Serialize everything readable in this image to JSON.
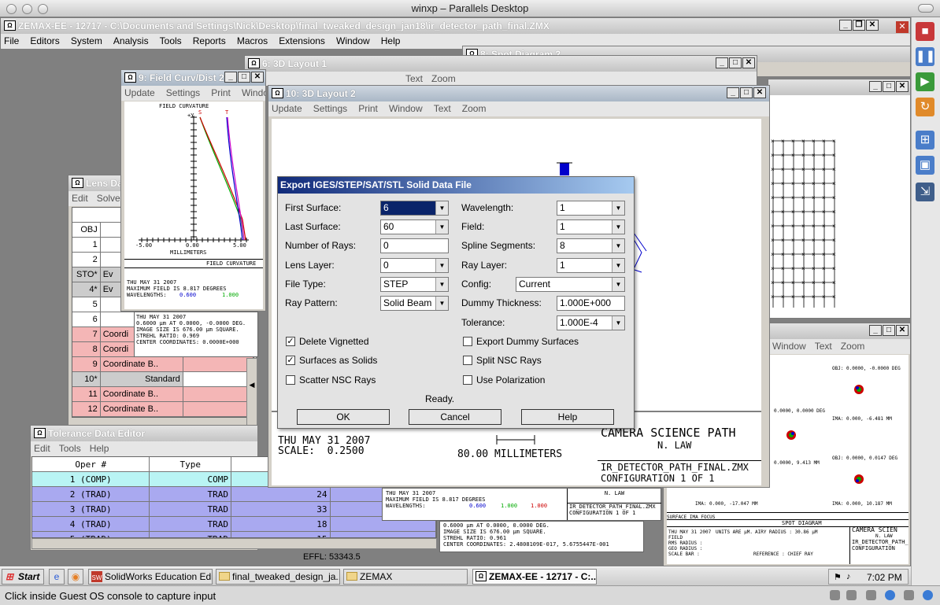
{
  "mac": {
    "title": "winxp – Parallels Desktop",
    "status": "Click inside Guest OS console to capture input"
  },
  "zemax": {
    "title": "ZEMAX-EE - 12717 - C:\\Documents and Settings\\Nick\\Desktop\\final_tweaked_design_jan18\\ir_detector_path_final.ZMX",
    "menu": [
      "File",
      "Editors",
      "System",
      "Analysis",
      "Tools",
      "Reports",
      "Macros",
      "Extensions",
      "Window",
      "Help"
    ]
  },
  "windows": {
    "spot_title": "8: Spot Diagram 2",
    "layout1_title": "6: 3D Layout 1",
    "layout1_menu": [
      "Text",
      "Zoom"
    ],
    "field_curv": {
      "title": "9: Field Curv/Dist 2",
      "menu": [
        "Update",
        "Settings",
        "Print",
        "Window"
      ],
      "plot_title": "FIELD CURVATURE",
      "y_label": "+Y",
      "s_label": "S",
      "t_label": "T",
      "x_ticks": [
        "-5.00",
        "0.00",
        "5.00"
      ],
      "x_label": "MILLIMETERS",
      "footer_label": "FIELD CURVATURE",
      "date": "THU MAY 31 2007",
      "max_field": "MAXIMUM FIELD IS 8.817 DEGREES",
      "wavelengths_label": "WAVELENGTHS:",
      "wl1": "0.600",
      "wl2": "1.000"
    },
    "layout2": {
      "title": "10: 3D Layout 2",
      "menu": [
        "Update",
        "Settings",
        "Print",
        "Window",
        "Text",
        "Zoom"
      ],
      "date": "THU MAY 31 2007",
      "scale": "SCALE:  0.2500",
      "scale_bar": "80.00 MILLIMETERS",
      "title_block": "CAMERA SCIENCE PATH",
      "author": "N. LAW",
      "file": "IR_DETECTOR_PATH_FINAL.ZMX",
      "config": "CONFIGURATION  1  OF  1"
    },
    "lens_data": {
      "title": "Lens Da",
      "menu": [
        "Edit",
        "Solves"
      ],
      "header": "Surf",
      "rows": [
        {
          "num": "OBJ",
          "type": ""
        },
        {
          "num": "1",
          "type": ""
        },
        {
          "num": "2",
          "type": ""
        },
        {
          "num": "STO*",
          "type": "Ev"
        },
        {
          "num": "4*",
          "type": "Ev"
        },
        {
          "num": "5",
          "type": ""
        },
        {
          "num": "6",
          "type": ""
        },
        {
          "num": "7",
          "type": "Coordi"
        },
        {
          "num": "8",
          "type": "Coordi"
        },
        {
          "num": "9",
          "type": "Coordinate B.."
        },
        {
          "num": "10*",
          "type": "Standard"
        },
        {
          "num": "11",
          "type": "Coordinate B.."
        },
        {
          "num": "12",
          "type": "Coordinate B.."
        }
      ]
    },
    "spot_small": {
      "date": "THU MAY 31 2007",
      "lines": [
        "0.6000 µm AT 0.0000, -0.0000 DEG.",
        "IMAGE SIZE IS 676.00 µm SQUARE.",
        "STREHL RATIO: 0.969",
        "CENTER COORDINATES: 0.0000E+000"
      ]
    },
    "tolerance": {
      "title": "Tolerance Data Editor",
      "menu": [
        "Edit",
        "Tools",
        "Help"
      ],
      "headers": [
        "Oper #",
        "Type"
      ],
      "rows": [
        {
          "oper": "1 (COMP)",
          "type": "COMP",
          "v": ""
        },
        {
          "oper": "2 (TRAD)",
          "type": "TRAD",
          "v": "24"
        },
        {
          "oper": "3 (TRAD)",
          "type": "TRAD",
          "v": "33"
        },
        {
          "oper": "4 (TRAD)",
          "type": "TRAD",
          "v": "18"
        },
        {
          "oper": "5 (TRAD)",
          "type": "TRAD",
          "v": "15"
        }
      ]
    },
    "effl": "EFFL: 53343.5",
    "fc2": {
      "date": "THU MAY 31 2007",
      "max_field": "MAXIMUM FIELD IS 8.817 DEGREES",
      "wavelengths_label": "WAVELENGTHS:",
      "wl1": "0.600",
      "wl2": "1.000",
      "wl3": "1.000",
      "title": "IR_DETECTOR_PATH_FINAL.ZMX",
      "author": "N. LAW",
      "config": "CONFIGURATION 1 OF 1"
    },
    "spot3": {
      "lines": [
        "0.6000 µm AT 0.0000, 0.0000 DEG.",
        "IMAGE SIZE IS 676.00 µm SQUARE.",
        "STREHL RATIO: 0.961",
        "CENTER COORDINATES: 2.4808109E-017, 5.6755447E-001"
      ]
    },
    "spot2": {
      "menu": [
        "Window",
        "Text",
        "Zoom"
      ],
      "labels": [
        "OBJ: 0.0000, -0.0000 DEG",
        "0.0000, 0.0000 DEG",
        "IMA: 0.000, -6.481 MM",
        "0.0000, 9.413 MM",
        "OBJ: 0.0000, 0.0147 DEG",
        "IMA: 0.000, 0.000 MM",
        "IMA: 0.000, -17.047 MM",
        "IMA: 0.000, 10.187 MM"
      ],
      "footer_title": "SPOT DIAGRAM",
      "footer_date": "THU MAY 31 2007",
      "footer_units": "UNITS ARE µM.",
      "footer_airy": "AIRY RADIUS : 30.86 µM",
      "footer_field": "FIELD",
      "footer_rms": "RMS RADIUS :",
      "footer_geo": "GEO RADIUS :",
      "footer_scale": "SCALE BAR :",
      "footer_ref": "REFERENCE : CHIEF RAY",
      "footer_focus": "SURFACE IMA FOCUS",
      "title": "CAMERA SCIEN",
      "author": "N. LAW",
      "file": "IR_DETECTOR_PATH_",
      "config": "CONFIGURATION"
    }
  },
  "dialog": {
    "title": "Export IGES/STEP/SAT/STL Solid Data File",
    "first_surface": {
      "label": "First Surface:",
      "value": "6"
    },
    "last_surface": {
      "label": "Last Surface:",
      "value": "60"
    },
    "num_rays": {
      "label": "Number of Rays:",
      "value": "0"
    },
    "lens_layer": {
      "label": "Lens Layer:",
      "value": "0"
    },
    "file_type": {
      "label": "File Type:",
      "value": "STEP"
    },
    "ray_pattern": {
      "label": "Ray Pattern:",
      "value": "Solid Beam"
    },
    "wavelength": {
      "label": "Wavelength:",
      "value": "1"
    },
    "field": {
      "label": "Field:",
      "value": "1"
    },
    "spline": {
      "label": "Spline Segments:",
      "value": "8"
    },
    "ray_layer": {
      "label": "Ray Layer:",
      "value": "1"
    },
    "config": {
      "label": "Config:",
      "value": "Current"
    },
    "dummy": {
      "label": "Dummy Thickness:",
      "value": "1.000E+000"
    },
    "tolerance": {
      "label": "Tolerance:",
      "value": "1.000E-4"
    },
    "delete_vignetted": {
      "label": "Delete Vignetted",
      "checked": "✓"
    },
    "surfaces_solids": {
      "label": "Surfaces as Solids",
      "checked": "✓"
    },
    "scatter_nsc": {
      "label": "Scatter NSC Rays",
      "checked": ""
    },
    "export_dummy": {
      "label": "Export Dummy Surfaces",
      "checked": ""
    },
    "split_nsc": {
      "label": "Split NSC Rays",
      "checked": ""
    },
    "use_polarization": {
      "label": "Use Polarization",
      "checked": ""
    },
    "status": "Ready.",
    "ok": "OK",
    "cancel": "Cancel",
    "help": "Help"
  },
  "taskbar": {
    "start": "Start",
    "items": [
      "SolidWorks Education Edi...",
      "final_tweaked_design_ja...",
      "ZEMAX",
      "ZEMAX-EE - 12717 - C:..."
    ],
    "time": "7:02 PM"
  },
  "colors": {
    "accent_title": "#0a246a",
    "lens_pink": "#f4b6b6",
    "tol_blue": "#a9a9f0",
    "tol_cyan": "#b9f4f4"
  }
}
